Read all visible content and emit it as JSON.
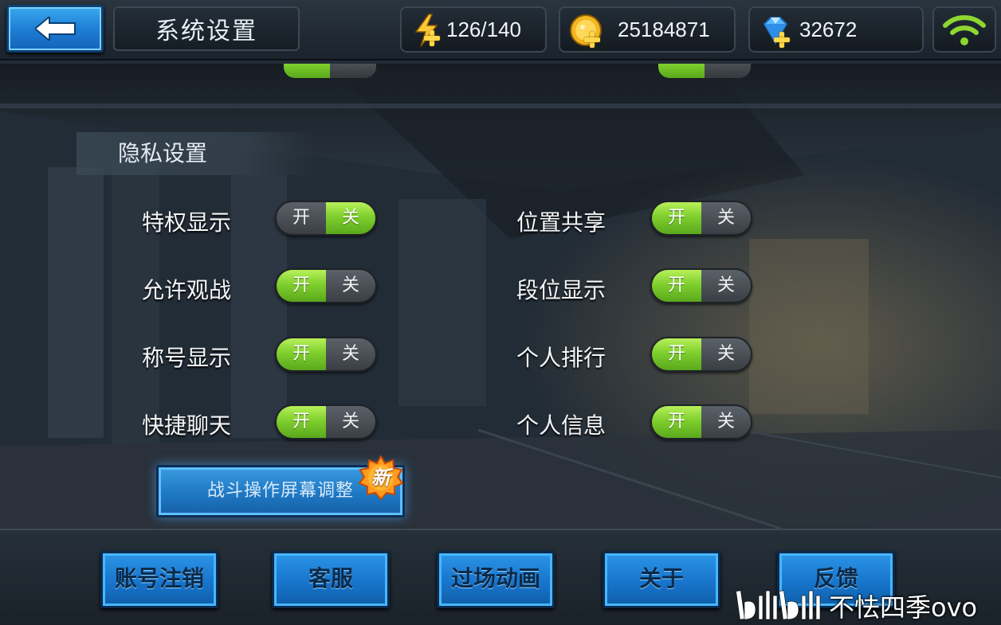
{
  "colors": {
    "toggle_on": "#7fcf2e",
    "toggle_off": "#4a4f55",
    "button_blue": "#1f78c4",
    "gold": "#ffd74a",
    "wifi_green": "#8ed630"
  },
  "header": {
    "back_icon": "back-arrow-icon",
    "title": "系统设置",
    "stamina": {
      "icon": "lightning-icon",
      "value": "126/140"
    },
    "gold": {
      "icon": "gold-coin-icon",
      "value": "25184871"
    },
    "diamond": {
      "icon": "diamond-icon",
      "value": "32672"
    },
    "signal_icon": "wifi-icon"
  },
  "privacy": {
    "title": "隐私设置",
    "on_label": "开",
    "off_label": "关",
    "left": [
      {
        "label": "特权显示",
        "state": "off"
      },
      {
        "label": "允许观战",
        "state": "on"
      },
      {
        "label": "称号显示",
        "state": "on"
      },
      {
        "label": "快捷聊天",
        "state": "on"
      }
    ],
    "right": [
      {
        "label": "位置共享",
        "state": "on"
      },
      {
        "label": "段位显示",
        "state": "on"
      },
      {
        "label": "个人排行",
        "state": "on"
      },
      {
        "label": "个人信息",
        "state": "on"
      }
    ]
  },
  "battle_button": {
    "label": "战斗操作屏幕调整",
    "badge": "新"
  },
  "footer": {
    "buttons": [
      "账号注销",
      "客服",
      "过场动画",
      "关于",
      "反馈"
    ]
  },
  "watermark": {
    "logo": "bilibili",
    "user": "不怯四季ovo"
  }
}
